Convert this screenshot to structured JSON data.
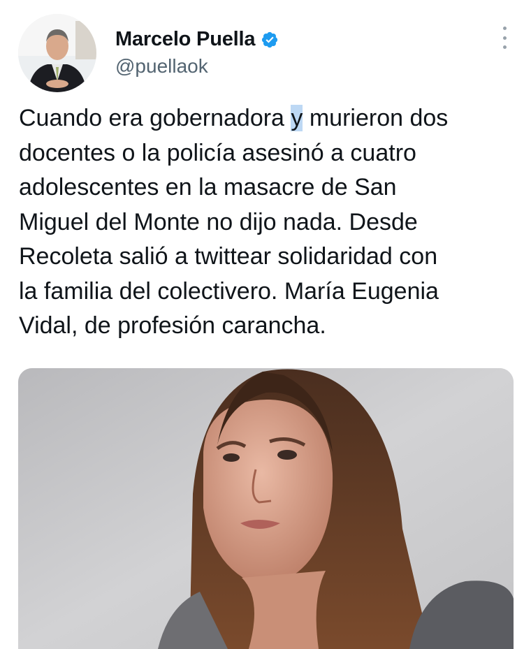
{
  "tweet": {
    "author": {
      "display_name": "Marcelo Puella",
      "handle": "@puellaok",
      "verified": true,
      "avatar_icon": "profile-photo"
    },
    "text_before_selection": "Cuando era gobernadora ",
    "selected_text": "y",
    "text_after_selection": " murieron dos\ndocentes o la policía asesinó a cuatro\nadolescentes en la masacre de San\nMiguel del Monte no dijo nada. Desde\nRecoleta salió a twittear solidaridad con\nla familia del colectivero. María Eugenia\nVidal, de profesión carancha.",
    "media": {
      "type": "photo",
      "icon": "portrait-photo"
    },
    "more_icon": "ellipsis-vertical-icon"
  },
  "colors": {
    "text_primary": "#0f1419",
    "text_secondary": "#536471",
    "verified_blue": "#1d9bf0",
    "selection": "#bdd8f4"
  }
}
